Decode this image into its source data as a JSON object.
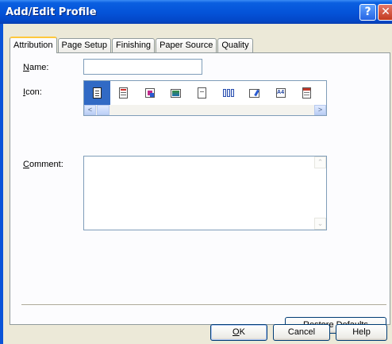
{
  "window": {
    "title": "Add/Edit Profile",
    "help_glyph": "?",
    "close_glyph": "✕"
  },
  "tabs": [
    {
      "label": "Attribution",
      "active": true
    },
    {
      "label": "Page Setup",
      "active": false
    },
    {
      "label": "Finishing",
      "active": false
    },
    {
      "label": "Paper Source",
      "active": false
    },
    {
      "label": "Quality",
      "active": false
    }
  ],
  "form": {
    "name_label_mnemonic": "N",
    "name_label_rest": "ame:",
    "name_value": "",
    "icon_label_mnemonic": "I",
    "icon_label_rest": "con:",
    "icons": [
      "standard-document-icon",
      "color-document-icon",
      "booklet-document-icon",
      "photo-document-icon",
      "plain-document-icon",
      "multi-page-document-icon",
      "edit-document-icon",
      "a4-document-icon",
      "calendar-document-icon"
    ],
    "icon_a4_text": "A4",
    "selected_icon_index": 0,
    "comment_label_mnemonic": "C",
    "comment_label_rest": "omment:",
    "comment_value": ""
  },
  "scroll": {
    "left_glyph": "<",
    "right_glyph": ">",
    "up_glyph": "⌃",
    "down_glyph": "⌄"
  },
  "buttons": {
    "restore_defaults_mnemonic": "R",
    "restore_defaults_rest": "estore Defaults",
    "ok_mnemonic": "O",
    "ok_rest": "K",
    "cancel": "Cancel",
    "help": "Help"
  },
  "colors": {
    "titlebar": "#0452d8",
    "dialog_bg": "#ece9d8",
    "selection": "#316ac5"
  }
}
